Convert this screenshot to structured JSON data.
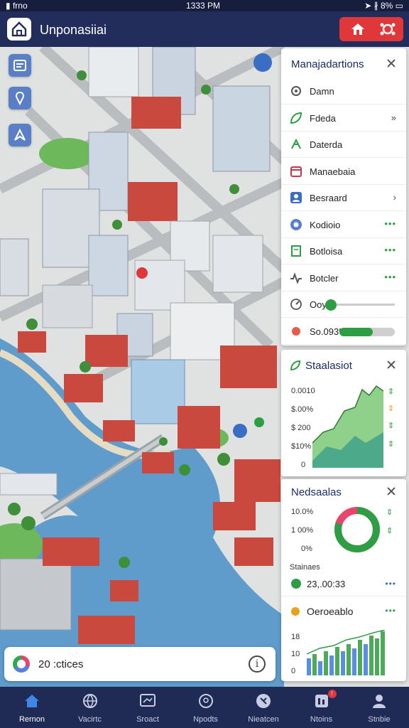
{
  "status_bar": {
    "left": "▮ frno",
    "time": "1333 PM",
    "right": "➤ ∦ 8% ▭"
  },
  "app": {
    "title": "Unponasiiai"
  },
  "colors": {
    "brand": "#232d5c",
    "accent": "#2e9e45",
    "alert": "#e0383a",
    "water": "#5f9ccc"
  },
  "map_controls": [
    {
      "icon": "layers-icon"
    },
    {
      "icon": "location-pin-icon"
    },
    {
      "icon": "compass-icon"
    }
  ],
  "management_panel": {
    "title": "Manajadartions",
    "items": [
      {
        "label": "Damn",
        "icon": "settings-icon",
        "trail": ""
      },
      {
        "label": "Fdeda",
        "icon": "leaf-icon",
        "trail": "»"
      },
      {
        "label": "Daterda",
        "icon": "network-icon",
        "trail": ""
      },
      {
        "label": "Manaebaia",
        "icon": "calendar-icon",
        "trail": ""
      },
      {
        "label": "Besraard",
        "icon": "user-icon",
        "trail": "›"
      },
      {
        "label": "Kodioio",
        "icon": "record-icon",
        "trail": "•••"
      },
      {
        "label": "Botloisa",
        "icon": "document-icon",
        "trail": "•••"
      },
      {
        "label": "Botcler",
        "icon": "pulse-icon",
        "trail": "•••"
      },
      {
        "label": "Ooy",
        "icon": "gauge-icon",
        "slider": 0.0
      },
      {
        "label": "So.093%",
        "icon": "status-dot-icon",
        "progress": 0.6
      }
    ]
  },
  "stats_panel": {
    "title": "Staalasiot",
    "y_labels": [
      "0.0010",
      "$.00%",
      "$ 200",
      "$10%",
      "0"
    ],
    "legend_marks": [
      "⇕",
      "⇕",
      "⇕",
      "⇕"
    ]
  },
  "media_panel": {
    "title": "Nedsaalas",
    "y_labels": [
      "10.0%",
      "1 00%",
      "0%"
    ],
    "donut_fraction": 0.8,
    "stat_label": "Stainaes",
    "stat_value": "23,.00:33",
    "channel_label": "Oeroeablo",
    "bar_y_labels": [
      "18",
      "10",
      "0"
    ],
    "more": "•••"
  },
  "stats_card": {
    "text": "20 :ctices",
    "info": "i"
  },
  "tabs": [
    {
      "label": "Rernon",
      "icon": "home-icon",
      "active": true
    },
    {
      "label": "Vacirtc",
      "icon": "globe-icon"
    },
    {
      "label": "Sroact",
      "icon": "screen-icon"
    },
    {
      "label": "Npodts",
      "icon": "search-icon"
    },
    {
      "label": "Nieatcen",
      "icon": "bell-icon"
    },
    {
      "label": "Ntoins",
      "icon": "grid-icon",
      "badge": "!"
    },
    {
      "label": "Stnbie",
      "icon": "profile-icon"
    }
  ]
}
